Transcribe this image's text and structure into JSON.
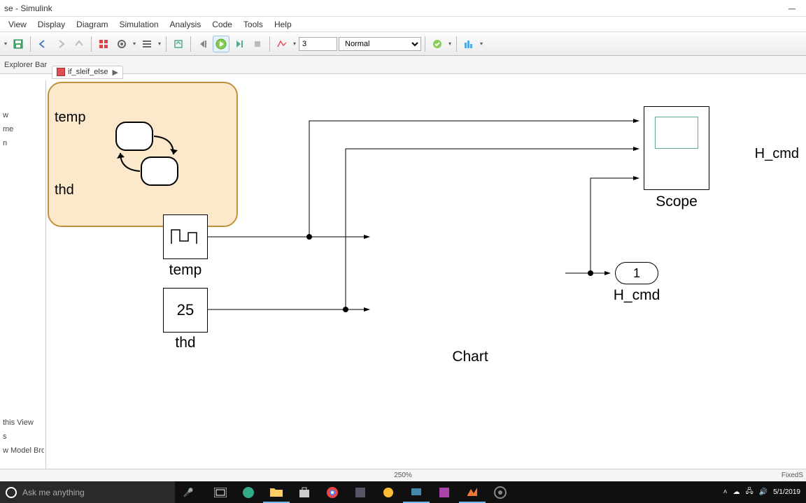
{
  "titlebar": {
    "text": "se - Simulink"
  },
  "menu": {
    "view": "View",
    "display": "Display",
    "diagram": "Diagram",
    "simulation": "Simulation",
    "analysis": "Analysis",
    "code": "Code",
    "tools": "Tools",
    "help": "Help"
  },
  "toolbar": {
    "stop_time": "3",
    "mode": "Normal"
  },
  "explorer": {
    "label": "Explorer Bar"
  },
  "tab": {
    "name": "if_sleif_else"
  },
  "sidepanel": {
    "items": [
      "w",
      "me",
      "n",
      "this View",
      "s",
      "w Model Browser"
    ]
  },
  "blocks": {
    "temp": {
      "label": "temp"
    },
    "thd": {
      "label": "thd",
      "value": "25"
    },
    "chart": {
      "label": "Chart",
      "in1": "temp",
      "in2": "thd",
      "out1": "H_cmd"
    },
    "scope": {
      "label": "Scope"
    },
    "outport": {
      "label": "H_cmd",
      "num": "1"
    }
  },
  "statusbar": {
    "zoom": "250%",
    "right": "FixedS"
  },
  "taskbar": {
    "search_placeholder": "Ask me anything",
    "date": "5/1/2019"
  },
  "chart_data": {
    "type": "diagram",
    "description": "Simulink block diagram",
    "blocks": [
      {
        "name": "temp",
        "type": "SignalBuilder",
        "outputs": [
          "signal"
        ]
      },
      {
        "name": "thd",
        "type": "Constant",
        "value": 25,
        "outputs": [
          "value"
        ]
      },
      {
        "name": "Chart",
        "type": "StateflowChart",
        "inputs": [
          "temp",
          "thd"
        ],
        "outputs": [
          "H_cmd"
        ]
      },
      {
        "name": "Scope",
        "type": "Scope",
        "inputs": [
          "in1",
          "in2",
          "in3"
        ]
      },
      {
        "name": "H_cmd",
        "type": "Outport",
        "number": 1,
        "inputs": [
          "in"
        ]
      }
    ],
    "connections": [
      {
        "from": "temp.signal",
        "to": "Chart.temp"
      },
      {
        "from": "temp.signal",
        "to": "Scope.in1"
      },
      {
        "from": "thd.value",
        "to": "Chart.thd"
      },
      {
        "from": "thd.value",
        "to": "Scope.in2"
      },
      {
        "from": "Chart.H_cmd",
        "to": "H_cmd.in"
      },
      {
        "from": "Chart.H_cmd",
        "to": "Scope.in3"
      }
    ]
  }
}
